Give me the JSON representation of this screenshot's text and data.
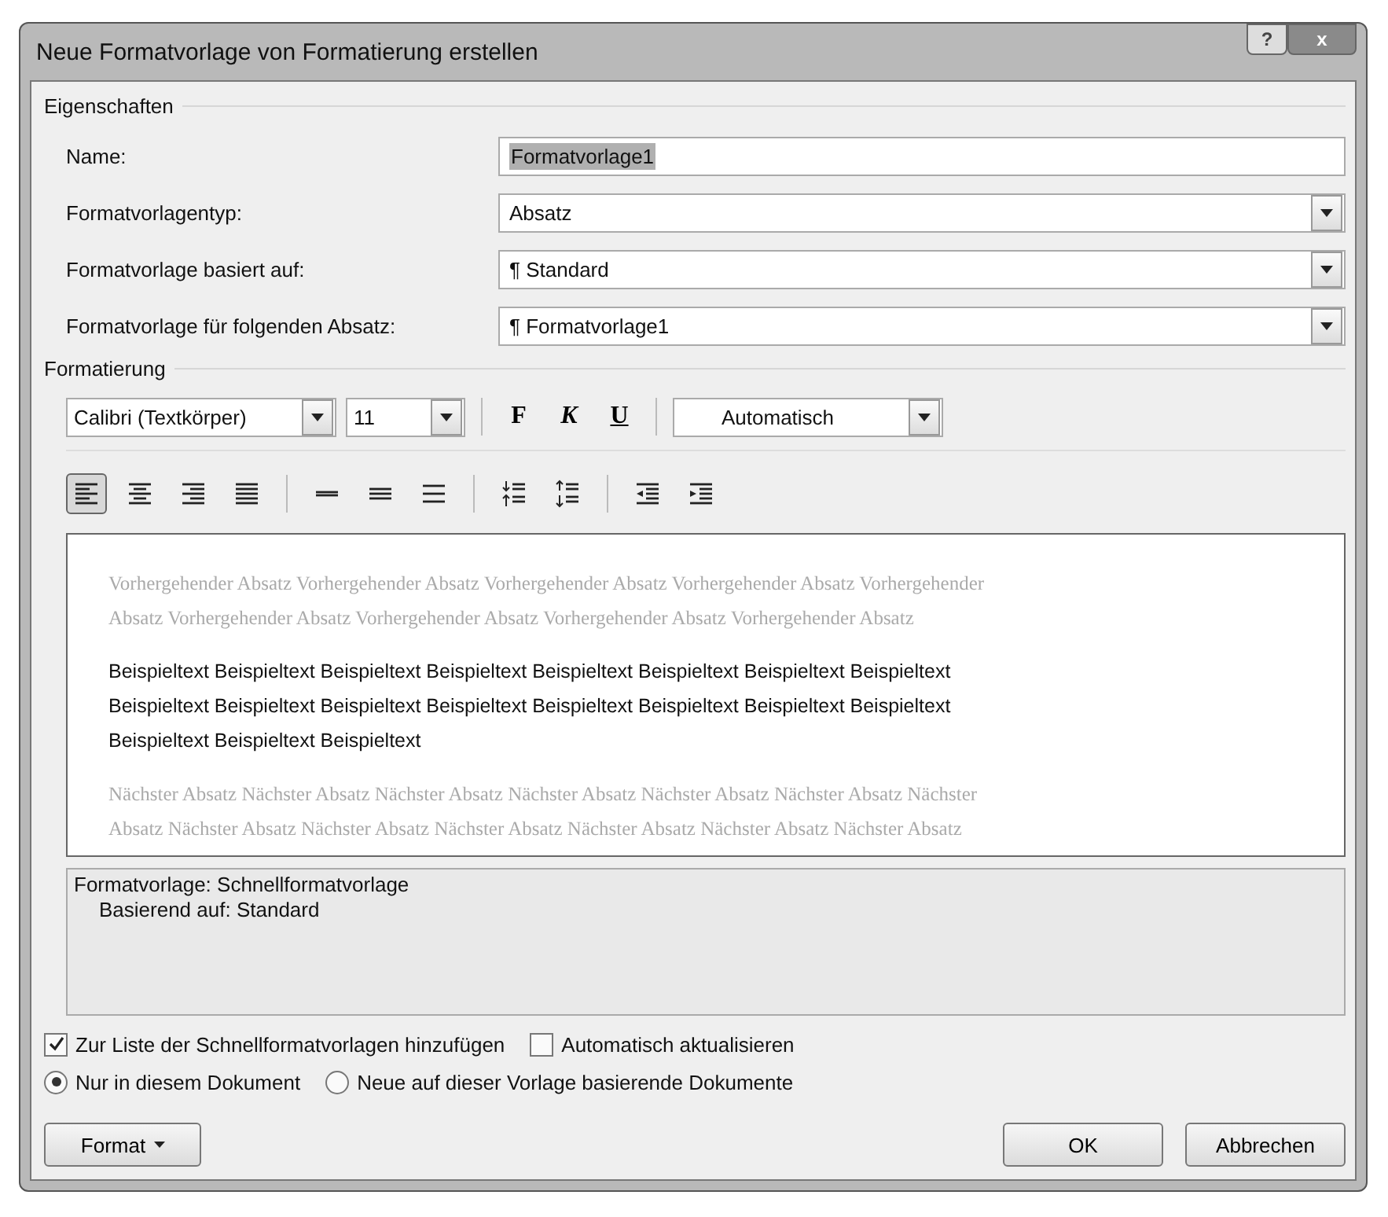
{
  "window": {
    "title": "Neue Formatvorlage von Formatierung erstellen",
    "buttons": [
      {
        "kind": "help",
        "label": "?"
      },
      {
        "kind": "close",
        "label": "x"
      }
    ]
  },
  "properties": {
    "title": "Eigenschaften",
    "rows": [
      {
        "label": "Name:",
        "kind": "text",
        "value": "Formatvorlage1",
        "selected_text": true
      },
      {
        "label": "Formatvorlagentyp:",
        "kind": "select",
        "value": "Absatz"
      },
      {
        "label": "Formatvorlage basiert auf:",
        "kind": "select",
        "value": "¶ Standard"
      },
      {
        "label": "Formatvorlage für folgenden Absatz:",
        "kind": "select",
        "value": "¶ Formatvorlage1"
      }
    ]
  },
  "formatting": {
    "title": "Formatierung",
    "font": "Calibri (Textkörper)",
    "size": "11",
    "styles": [
      {
        "label": "F",
        "kind": "bold"
      },
      {
        "label": "K",
        "kind": "italic"
      },
      {
        "label": "U",
        "kind": "underline"
      }
    ],
    "text_color": "Automatisch",
    "paragraph_buttons": [
      {
        "kind": "align-left",
        "selected": true
      },
      {
        "kind": "align-center",
        "selected": false
      },
      {
        "kind": "align-right",
        "selected": false
      },
      {
        "kind": "justify",
        "selected": false
      },
      {
        "kind": "single-spacing",
        "selected": false
      },
      {
        "kind": "one-half-spacing",
        "selected": false
      },
      {
        "kind": "double-spacing",
        "selected": false
      },
      {
        "kind": "spacing-before",
        "selected": false
      },
      {
        "kind": "spacing-after",
        "selected": false
      },
      {
        "kind": "indent-decrease",
        "selected": false
      },
      {
        "kind": "indent-increase",
        "selected": false
      }
    ]
  },
  "preview": {
    "previous": [
      "Vorhergehender Absatz Vorhergehender Absatz Vorhergehender Absatz Vorhergehender Absatz Vorhergehender",
      "Absatz Vorhergehender Absatz Vorhergehender Absatz Vorhergehender Absatz Vorhergehender Absatz"
    ],
    "sample": [
      "Beispieltext Beispieltext Beispieltext Beispieltext Beispieltext Beispieltext Beispieltext Beispieltext",
      "Beispieltext Beispieltext Beispieltext Beispieltext Beispieltext Beispieltext Beispieltext Beispieltext",
      "Beispieltext Beispieltext Beispieltext"
    ],
    "next": [
      "Nächster Absatz Nächster Absatz Nächster Absatz Nächster Absatz Nächster Absatz Nächster Absatz Nächster",
      "Absatz Nächster Absatz Nächster Absatz Nächster Absatz Nächster Absatz Nächster Absatz Nächster Absatz"
    ]
  },
  "description": [
    "Formatvorlage: Schnellformatvorlage",
    "Basierend auf: Standard"
  ],
  "checkboxes": [
    {
      "label": "Zur Liste der Schnellformatvorlagen hinzufügen",
      "checked": true
    },
    {
      "label": "Automatisch aktualisieren",
      "checked": false
    }
  ],
  "radios": [
    {
      "label": "Nur in diesem Dokument",
      "selected": true
    },
    {
      "label": "Neue auf dieser Vorlage basierende Dokumente",
      "selected": false
    }
  ],
  "buttons": [
    {
      "kind": "menu",
      "label": "Format"
    },
    {
      "kind": "ok",
      "label": "OK"
    },
    {
      "kind": "cancel",
      "label": "Abbrechen"
    }
  ]
}
